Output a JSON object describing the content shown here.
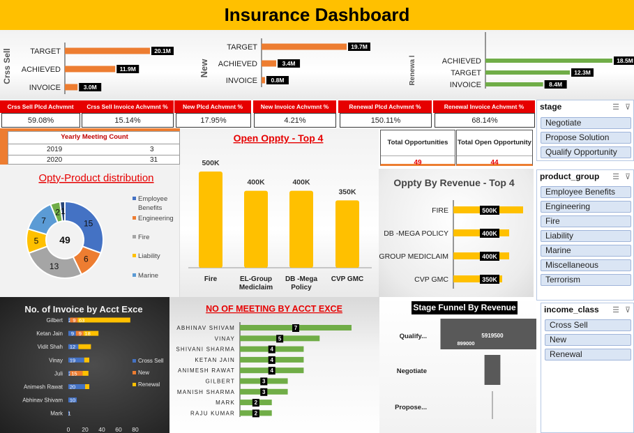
{
  "header": {
    "title": "Insurance Dashboard"
  },
  "cross_sell": {
    "section_label": "Crss Sell",
    "rows": [
      {
        "label": "TARGET",
        "value": 20.1,
        "display": "20.1M"
      },
      {
        "label": "ACHIEVED",
        "value": 11.9,
        "display": "11.9M"
      },
      {
        "label": "INVOICE",
        "value": 3.0,
        "display": "3.0M"
      }
    ]
  },
  "new": {
    "section_label": "New",
    "rows": [
      {
        "label": "TARGET",
        "value": 19.7,
        "display": "19.7M"
      },
      {
        "label": "ACHIEVED",
        "value": 3.4,
        "display": "3.4M"
      },
      {
        "label": "INVOICE",
        "value": 0.8,
        "display": "0.8M"
      }
    ]
  },
  "renewal": {
    "section_label": "Renewa l",
    "rows": [
      {
        "label": "ACHIEVED",
        "value": 18.5,
        "display": "18.5M"
      },
      {
        "label": "TARGET",
        "value": 12.3,
        "display": "12.3M"
      },
      {
        "label": "INVOICE",
        "value": 8.4,
        "display": "8.4M"
      }
    ]
  },
  "kpis": [
    {
      "label": "Crss Sell Plcd Achvmnt",
      "value": "59.08%"
    },
    {
      "label": "Crss Sell Invoice Achvmnt  %",
      "value": "15.14%"
    },
    {
      "label": "New Plcd Achvmnt %",
      "value": "17.95%"
    },
    {
      "label": "New Invoice Achvmnt %",
      "value": "4.21%"
    },
    {
      "label": "Renewal Plcd Achvmnt %",
      "value": "150.11%"
    },
    {
      "label": "Renewal Invoice Achvmnt %",
      "value": "68.14%"
    }
  ],
  "yearly_meeting": {
    "title": "Yearly Meeting Count",
    "rows": [
      {
        "year": "2019",
        "count": "3"
      },
      {
        "year": "2020",
        "count": "31"
      }
    ]
  },
  "opportunities": {
    "total_label": "Total Opportunities",
    "total_value": "49",
    "open_label": "Total Open Opportunity",
    "open_value": "44"
  },
  "colors": {
    "accent_yellow": "#ffc000",
    "orange": "#ed7d31",
    "green": "#70ad47",
    "blue": "#4472c4",
    "gray": "#a5a5a5",
    "red": "#e60000",
    "light_blue": "#5b9bd5"
  },
  "slicers": {
    "stage": {
      "title": "stage",
      "items": [
        "Negotiate",
        "Propose Solution",
        "Qualify Opportunity"
      ]
    },
    "product_group": {
      "title": "product_group",
      "items": [
        "Employee Benefits",
        "Engineering",
        "Fire",
        "Liability",
        "Marine",
        "Miscellaneous",
        "Terrorism"
      ]
    },
    "income_class": {
      "title": "income_class",
      "items": [
        "Cross Sell",
        "New",
        "Renewal"
      ]
    }
  },
  "chart_data": [
    {
      "type": "pie",
      "title": "Opty-Product distribution",
      "center_label": "49",
      "slices": [
        {
          "name": "Employee Benefits",
          "value": 15,
          "color": "#4472c4"
        },
        {
          "name": "Engineering",
          "value": 6,
          "color": "#ed7d31"
        },
        {
          "name": "Fire",
          "value": 13,
          "color": "#a5a5a5"
        },
        {
          "name": "Liability",
          "value": 5,
          "color": "#ffc000"
        },
        {
          "name": "Marine",
          "value": 7,
          "color": "#5b9bd5"
        },
        {
          "name": "",
          "value": 2,
          "color": "#70ad47"
        },
        {
          "name": "",
          "value": 1,
          "color": "#264478"
        }
      ],
      "legend": [
        "Employee Benefits",
        "Engineering",
        "Fire",
        "Liability",
        "Marine"
      ],
      "legend_placement": "right"
    },
    {
      "type": "bar",
      "title": "Open Oppty - Top 4",
      "categories": [
        "Fire",
        "EL-Group Mediclaim",
        "DB -Mega Policy",
        "CVP GMC"
      ],
      "values": [
        500,
        400,
        400,
        350
      ],
      "labels": [
        "500K",
        "400K",
        "400K",
        "350K"
      ],
      "color": "#ffc000"
    },
    {
      "type": "bar",
      "title": "Oppty By Revenue - Top 4",
      "orientation": "horizontal",
      "categories": [
        "FIRE",
        "DB -MEGA POLICY",
        "-GROUP MEDICLAIM",
        "CVP GMC"
      ],
      "values": [
        500,
        400,
        400,
        350
      ],
      "labels": [
        "500K",
        "400K",
        "400K",
        "350K"
      ],
      "color": "#ffc000"
    },
    {
      "type": "bar",
      "title": "No. of Invoice by Acct Exce",
      "orientation": "horizontal",
      "stacked": true,
      "categories": [
        "Gilbert",
        "Ketan Jain",
        "Vidit Shah",
        "Vinay",
        "Juli",
        "Animesh Rawat",
        "Abhinav Shivam",
        "Mark"
      ],
      "series": [
        {
          "name": "Cross Sell",
          "values": [
            2,
            9,
            12,
            19,
            2,
            20,
            10,
            1
          ],
          "color": "#4472c4"
        },
        {
          "name": "New",
          "values": [
            9,
            9,
            0,
            0,
            15,
            0,
            0,
            0
          ],
          "color": "#ed7d31"
        },
        {
          "name": "Renewal",
          "values": [
            63,
            18,
            15,
            6,
            7,
            5,
            0,
            0
          ],
          "color": "#ffc000"
        }
      ],
      "data_labels": [
        [
          "2",
          "9",
          "63"
        ],
        [
          "9",
          "9",
          "18"
        ],
        [
          "12",
          "15",
          ""
        ],
        [
          "19",
          "",
          ""
        ],
        [
          "2",
          "15",
          ""
        ],
        [
          "20",
          "",
          ""
        ],
        [
          "10",
          "",
          ""
        ],
        [
          "1",
          "",
          ""
        ]
      ],
      "xticks": [
        "0",
        "20",
        "40",
        "60",
        "80"
      ],
      "xlim": [
        0,
        80
      ],
      "legend_placement": "right"
    },
    {
      "type": "bar",
      "title": "NO OF MEETING BY ACCT EXCE",
      "orientation": "horizontal",
      "categories": [
        "ABHINAV SHIVAM",
        "VINAY",
        "SHIVANI SHARMA",
        "KETAN JAIN",
        "ANIMESH RAWAT",
        "GILBERT",
        "MANISH SHARMA",
        "MARK",
        "RAJU KUMAR"
      ],
      "values": [
        7,
        5,
        4,
        4,
        4,
        3,
        3,
        2,
        2
      ],
      "color": "#70ad47"
    },
    {
      "type": "bar",
      "title": "Stage Funnel By Revenue",
      "orientation": "funnel",
      "categories": [
        "Qualify...",
        "Negotiate",
        "Propose..."
      ],
      "values": [
        5919500,
        899000,
        0
      ],
      "labels": [
        "5919500",
        "899000",
        ""
      ],
      "color": "#595959"
    }
  ]
}
